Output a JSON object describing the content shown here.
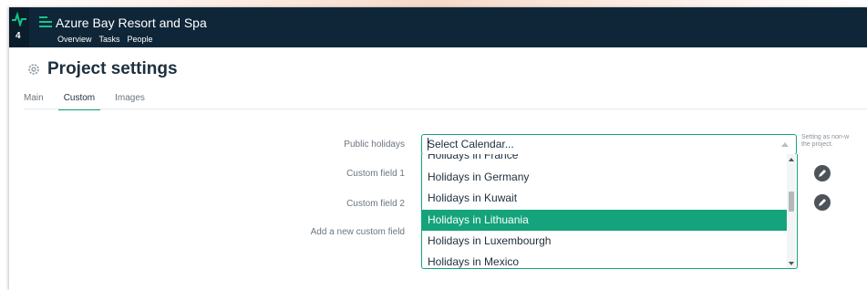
{
  "app": {
    "title": "Azure Bay Resort and Spa",
    "badge_count": "4",
    "nav": [
      "Overview",
      "Tasks",
      "People"
    ]
  },
  "page": {
    "title": "Project settings",
    "tabs": [
      "Main",
      "Custom",
      "Images"
    ],
    "active_tab": "Custom"
  },
  "form": {
    "public_holidays_label": "Public holidays",
    "custom_field_1_label": "Custom field 1",
    "custom_field_2_label": "Custom field 2",
    "add_custom_field_label": "Add a new custom field",
    "calendar_select_value": "Select Calendar...",
    "help_text_line1": "Setting as non-w",
    "help_text_line2": "the project."
  },
  "dropdown": {
    "options": [
      "Holidays in France",
      "Holidays in Germany",
      "Holidays in Kuwait",
      "Holidays in Lithuania",
      "Holidays in Luxembourgh",
      "Holidays in Mexico"
    ],
    "highlighted": "Holidays in Lithuania"
  },
  "colors": {
    "navbar": "#0f2638",
    "accent": "#14a37a",
    "text": "#1e2f3d"
  },
  "icons": {
    "app": "pulse-icon",
    "menu": "hamburger-icon",
    "settings": "gear-icon",
    "edit": "pencil-icon"
  }
}
